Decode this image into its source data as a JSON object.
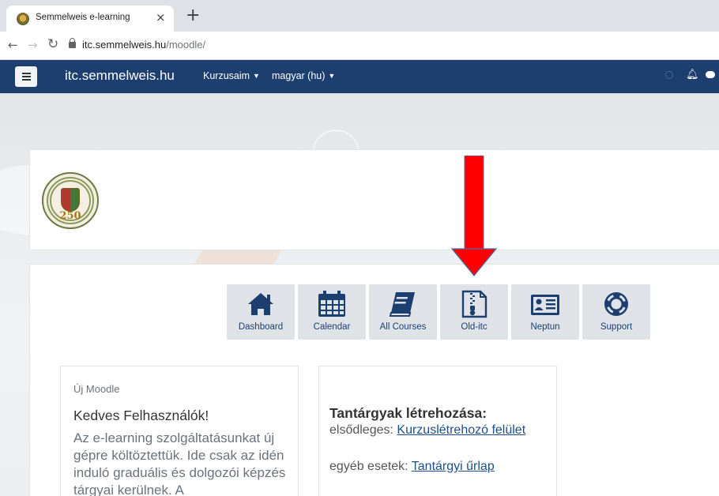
{
  "browser": {
    "tab_title": "Semmelweis e-learning",
    "tab_close": "×",
    "new_tab": "+",
    "url_host": "itc.semmelweis.hu",
    "url_path": "/moodle/"
  },
  "navbar": {
    "site_name": "itc.semmelweis.hu",
    "menu_courses": "Kurzusaim",
    "menu_language": "magyar (hu)",
    "accent": "#1c3f70"
  },
  "header": {
    "logo_number": "250"
  },
  "tiles": [
    {
      "label": "Dashboard",
      "icon": "home-icon"
    },
    {
      "label": "Calendar",
      "icon": "calendar-icon"
    },
    {
      "label": "All Courses",
      "icon": "book-icon"
    },
    {
      "label": "Old-itc",
      "icon": "zip-file-icon"
    },
    {
      "label": "Neptun",
      "icon": "id-card-icon"
    },
    {
      "label": "Support",
      "icon": "life-ring-icon"
    }
  ],
  "annotation": {
    "arrow_color": "#ff0000",
    "points_to": "Old-itc"
  },
  "card_moodle": {
    "title": "Új Moodle",
    "greeting": "Kedves Felhasználók!",
    "body": "Az e-learning szolgáltatásunkat új gépre költöztettük. Ide csak az idén induló graduális és dolgozói képzés tárgyai kerülnek. A"
  },
  "card_courses": {
    "title": "Tantárgyak létrehozása:",
    "primary_prefix": "elsődleges: ",
    "primary_link": "Kurzuslétrehozó felület",
    "other_prefix": "egyéb esetek: ",
    "other_link": "Tantárgyi űrlap"
  }
}
